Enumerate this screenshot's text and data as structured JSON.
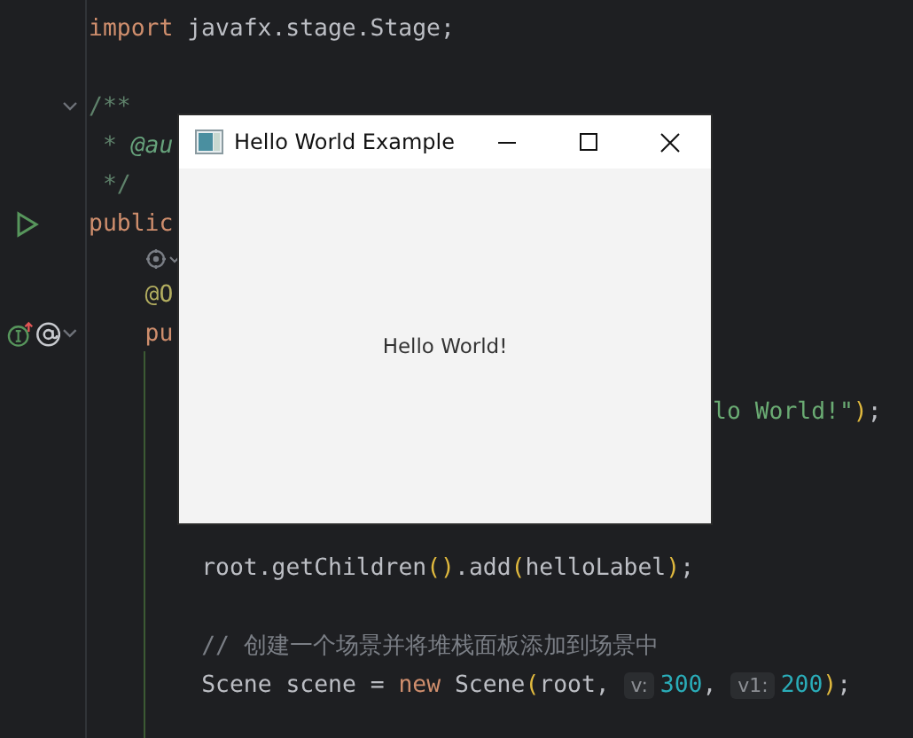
{
  "editor": {
    "lines": [
      {
        "kind": "code",
        "tokens": [
          {
            "kind": "keyword",
            "text": "import"
          },
          {
            "kind": "plain",
            "text": " javafx.stage.Stage;"
          }
        ]
      },
      {
        "kind": "blank"
      },
      {
        "kind": "code",
        "markers": [
          {
            "kind": "fold"
          }
        ],
        "tokens": [
          {
            "kind": "doc",
            "text": "/**"
          }
        ]
      },
      {
        "kind": "code",
        "tokens": [
          {
            "kind": "doc",
            "text": " * "
          },
          {
            "kind": "doctag",
            "text": "@au"
          }
        ]
      },
      {
        "kind": "code",
        "tokens": [
          {
            "kind": "doc",
            "text": " */"
          }
        ]
      },
      {
        "kind": "code",
        "markers": [
          {
            "kind": "run"
          }
        ],
        "tokens": [
          {
            "kind": "keyword",
            "text": "public"
          }
        ],
        "children": [
          {
            "kind": "inlay"
          },
          {
            "kind": "code",
            "tokens": [
              {
                "kind": "annotation",
                "text": "@O"
              }
            ]
          },
          {
            "kind": "code",
            "markers": [
              {
                "kind": "implements"
              },
              {
                "kind": "annotation"
              },
              {
                "kind": "fold"
              }
            ],
            "tokens": [
              {
                "kind": "keyword",
                "text": "pu"
              }
            ],
            "children": [
              {
                "kind": "blank"
              },
              {
                "kind": "covered",
                "tokens": [
                  {
                    "kind": "string",
                    "text": "lo World!\""
                  },
                  {
                    "kind": "paren",
                    "text": ")"
                  },
                  {
                    "kind": "plain",
                    "text": ";"
                  }
                ]
              },
              {
                "kind": "blank"
              },
              {
                "kind": "blank"
              },
              {
                "kind": "blank"
              },
              {
                "kind": "code",
                "tokens": [
                  {
                    "kind": "plain",
                    "text": "root.getChildren"
                  },
                  {
                    "kind": "paren",
                    "text": "()"
                  },
                  {
                    "kind": "plain",
                    "text": ".add"
                  },
                  {
                    "kind": "paren",
                    "text": "("
                  },
                  {
                    "kind": "plain",
                    "text": "helloLabel"
                  },
                  {
                    "kind": "paren",
                    "text": ")"
                  },
                  {
                    "kind": "plain",
                    "text": ";"
                  }
                ]
              },
              {
                "kind": "blank"
              },
              {
                "kind": "code",
                "tokens": [
                  {
                    "kind": "comment",
                    "text": "// 创建一个场景并将堆栈面板添加到场景中"
                  }
                ]
              },
              {
                "kind": "code",
                "tokens": [
                  {
                    "kind": "plain",
                    "text": "Scene scene = "
                  },
                  {
                    "kind": "keyword",
                    "text": "new"
                  },
                  {
                    "kind": "plain",
                    "text": " Scene"
                  },
                  {
                    "kind": "paren",
                    "text": "("
                  },
                  {
                    "kind": "plain",
                    "text": "root, "
                  },
                  {
                    "kind": "hint",
                    "text": "v:"
                  },
                  {
                    "kind": "number",
                    "text": "300"
                  },
                  {
                    "kind": "plain",
                    "text": ", "
                  },
                  {
                    "kind": "hint",
                    "text": "v1:"
                  },
                  {
                    "kind": "number",
                    "text": "200"
                  },
                  {
                    "kind": "paren",
                    "text": ")"
                  },
                  {
                    "kind": "plain",
                    "text": ";"
                  }
                ]
              }
            ]
          }
        ]
      }
    ]
  },
  "app_window": {
    "title": "Hello World Example",
    "label": "Hello World!"
  }
}
